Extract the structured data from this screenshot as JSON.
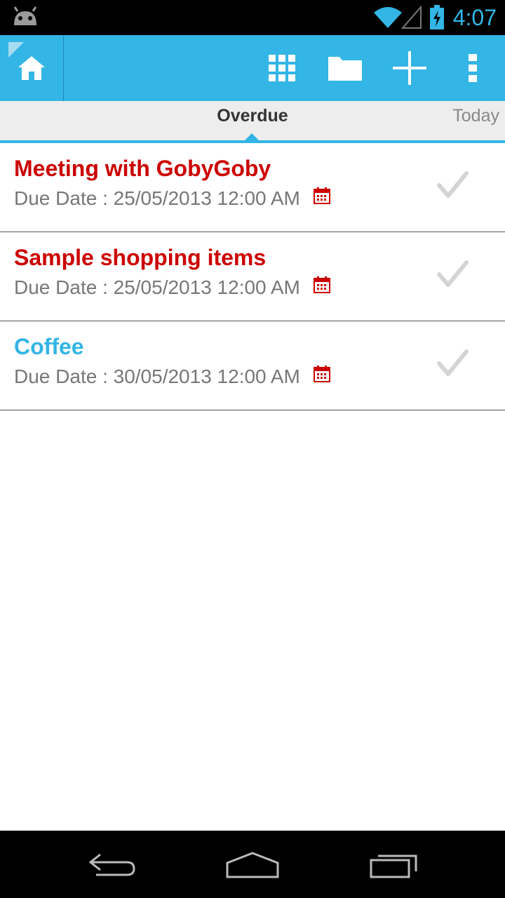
{
  "status_bar": {
    "time": "4:07",
    "icons": [
      "android-icon",
      "wifi-icon",
      "signal-icon",
      "battery-charging-icon"
    ]
  },
  "action_bar": {
    "accent_color": "#33b5e5",
    "buttons": [
      "home-icon",
      "grid-icon",
      "folder-icon",
      "plus-icon",
      "overflow-menu-icon"
    ]
  },
  "tabs": {
    "active": "Overdue",
    "next": "Today"
  },
  "tasks": [
    {
      "title": "Meeting with GobyGoby",
      "due": "Due Date : 25/05/2013 12:00 AM",
      "title_color": "#cc0000"
    },
    {
      "title": "Sample shopping items",
      "due": "Due Date : 25/05/2013 12:00 AM",
      "title_color": "#cc0000"
    },
    {
      "title": "Coffee",
      "due": "Due Date : 30/05/2013 12:00 AM",
      "title_color": "#33b5e5"
    }
  ],
  "nav_bar": {
    "buttons": [
      "back-icon",
      "home-nav-icon",
      "recent-apps-icon"
    ]
  }
}
